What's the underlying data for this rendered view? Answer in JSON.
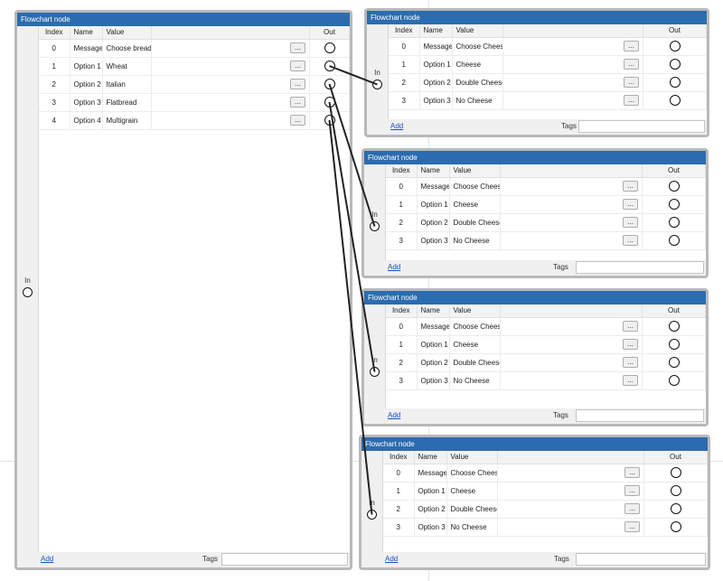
{
  "nodes": [
    {
      "title": "Flowchart node",
      "in_label": "In",
      "columns": {
        "index": "Index",
        "name": "Name",
        "value": "Value",
        "out": "Out"
      },
      "rows": [
        {
          "index": "0",
          "name": "Message",
          "value": "Choose bread."
        },
        {
          "index": "1",
          "name": "Option 1",
          "value": "Wheat"
        },
        {
          "index": "2",
          "name": "Option 2",
          "value": "Italian"
        },
        {
          "index": "3",
          "name": "Option 3",
          "value": "Flatbread"
        },
        {
          "index": "4",
          "name": "Option 4",
          "value": "Multigrain"
        }
      ],
      "button_label": "...",
      "add_label": "Add",
      "tags_label": "Tags",
      "tags_value": ""
    },
    {
      "title": "Flowchart node",
      "in_label": "In",
      "columns": {
        "index": "Index",
        "name": "Name",
        "value": "Value",
        "out": "Out"
      },
      "rows": [
        {
          "index": "0",
          "name": "Message",
          "value": "Choose Cheese."
        },
        {
          "index": "1",
          "name": "Option 1",
          "value": "Cheese"
        },
        {
          "index": "2",
          "name": "Option 2",
          "value": "Double Cheese"
        },
        {
          "index": "3",
          "name": "Option 3",
          "value": "No Cheese"
        }
      ],
      "button_label": "...",
      "add_label": "Add",
      "tags_label": "Tags",
      "tags_value": ""
    },
    {
      "title": "Flowchart node",
      "in_label": "In",
      "columns": {
        "index": "Index",
        "name": "Name",
        "value": "Value",
        "out": "Out"
      },
      "rows": [
        {
          "index": "0",
          "name": "Message",
          "value": "Choose Cheese."
        },
        {
          "index": "1",
          "name": "Option 1",
          "value": "Cheese"
        },
        {
          "index": "2",
          "name": "Option 2",
          "value": "Double Cheese"
        },
        {
          "index": "3",
          "name": "Option 3",
          "value": "No Cheese"
        }
      ],
      "button_label": "...",
      "add_label": "Add",
      "tags_label": "Tags",
      "tags_value": ""
    },
    {
      "title": "Flowchart node",
      "in_label": "In",
      "columns": {
        "index": "Index",
        "name": "Name",
        "value": "Value",
        "out": "Out"
      },
      "rows": [
        {
          "index": "0",
          "name": "Message",
          "value": "Choose Cheese."
        },
        {
          "index": "1",
          "name": "Option 1",
          "value": "Cheese"
        },
        {
          "index": "2",
          "name": "Option 2",
          "value": "Double Cheese"
        },
        {
          "index": "3",
          "name": "Option 3",
          "value": "No Cheese"
        }
      ],
      "button_label": "...",
      "add_label": "Add",
      "tags_label": "Tags",
      "tags_value": ""
    },
    {
      "title": "Flowchart node",
      "in_label": "In",
      "columns": {
        "index": "Index",
        "name": "Name",
        "value": "Value",
        "out": "Out"
      },
      "rows": [
        {
          "index": "0",
          "name": "Message",
          "value": "Choose Cheese."
        },
        {
          "index": "1",
          "name": "Option 1",
          "value": "Cheese"
        },
        {
          "index": "2",
          "name": "Option 2",
          "value": "Double Cheese"
        },
        {
          "index": "3",
          "name": "Option 3",
          "value": "No Cheese"
        }
      ],
      "button_label": "...",
      "add_label": "Add",
      "tags_label": "Tags",
      "tags_value": ""
    }
  ],
  "connections": [
    {
      "from_node": 0,
      "from_row": 1,
      "to_node": 1
    },
    {
      "from_node": 0,
      "from_row": 2,
      "to_node": 2
    },
    {
      "from_node": 0,
      "from_row": 3,
      "to_node": 3
    },
    {
      "from_node": 0,
      "from_row": 4,
      "to_node": 4
    }
  ],
  "colors": {
    "title_bar": "#2b6cb0",
    "wire": "#222222",
    "link": "#1a4fc4"
  }
}
